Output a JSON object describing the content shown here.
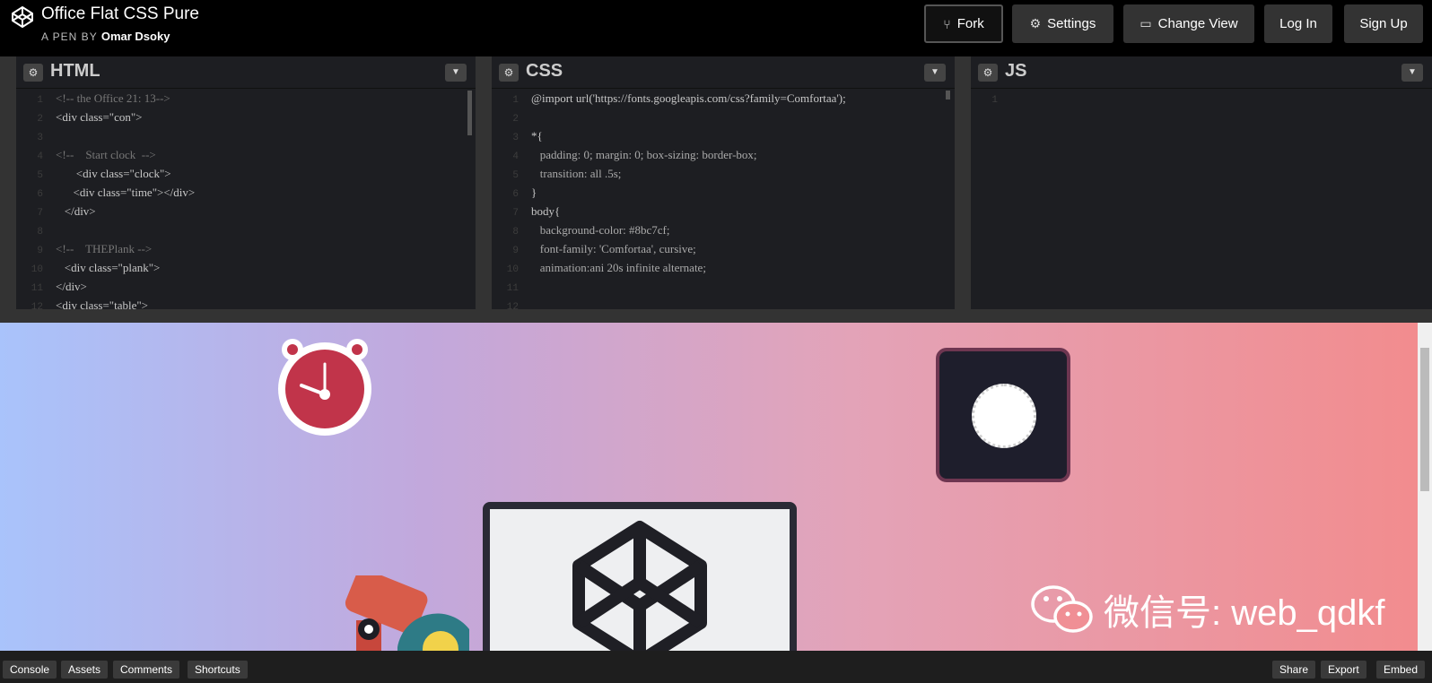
{
  "pen": {
    "title": "Office Flat CSS Pure",
    "byline_prefix": "A PEN BY",
    "author": "Omar Dsoky"
  },
  "header_buttons": {
    "fork": "Fork",
    "settings": "Settings",
    "change_view": "Change View",
    "login": "Log In",
    "signup": "Sign Up"
  },
  "panes": {
    "html": {
      "name": "HTML",
      "lines": [
        {
          "n": "1",
          "text": "<!-- the Office 21: 13-->",
          "cls": "cm"
        },
        {
          "n": "2",
          "text": "<div class=\"con\">",
          "cls": "tg"
        },
        {
          "n": "3",
          "text": "",
          "cls": "tg"
        },
        {
          "n": "4",
          "text": "<!--    Start clock  -->",
          "cls": "cm"
        },
        {
          "n": "5",
          "text": "       <div class=\"clock\">",
          "cls": "tg"
        },
        {
          "n": "6",
          "text": "      <div class=\"time\"></div>",
          "cls": "tg"
        },
        {
          "n": "7",
          "text": "   </div>",
          "cls": "tg"
        },
        {
          "n": "8",
          "text": "",
          "cls": "tg"
        },
        {
          "n": "9",
          "text": "<!--    THEPlank -->",
          "cls": "cm"
        },
        {
          "n": "10",
          "text": "   <div class=\"plank\">",
          "cls": "tg"
        },
        {
          "n": "11",
          "text": "</div>",
          "cls": "tg"
        },
        {
          "n": "12",
          "text": "<div class=\"table\">",
          "cls": "tg"
        }
      ]
    },
    "css": {
      "name": "CSS",
      "lines": [
        {
          "n": "1",
          "text": "@import url('https://fonts.googleapis.com/css?family=Comfortaa');",
          "cls": "tg"
        },
        {
          "n": "2",
          "text": "",
          "cls": "tg"
        },
        {
          "n": "3",
          "text": "*{",
          "cls": "tg"
        },
        {
          "n": "4",
          "text": "   padding: 0; margin: 0; box-sizing: border-box;",
          "cls": "pr"
        },
        {
          "n": "5",
          "text": "   transition: all .5s;",
          "cls": "pr"
        },
        {
          "n": "6",
          "text": "}",
          "cls": "tg"
        },
        {
          "n": "7",
          "text": "body{",
          "cls": "tg"
        },
        {
          "n": "8",
          "text": "   background-color: #8bc7cf;",
          "cls": "pr"
        },
        {
          "n": "9",
          "text": "   font-family: 'Comfortaa', cursive;",
          "cls": "pr"
        },
        {
          "n": "10",
          "text": "   animation:ani 20s infinite alternate;",
          "cls": "pr"
        },
        {
          "n": "11",
          "text": "",
          "cls": "tg"
        },
        {
          "n": "12",
          "text": "",
          "cls": "tg"
        }
      ]
    },
    "js": {
      "name": "JS",
      "lines": [
        {
          "n": "1",
          "text": "",
          "cls": "tg"
        }
      ]
    }
  },
  "watermark": {
    "text": "微信号: web_qdkf"
  },
  "bottom_buttons": {
    "console": "Console",
    "assets": "Assets",
    "comments": "Comments",
    "shortcuts": "Shortcuts",
    "share": "Share",
    "export": "Export",
    "embed": "Embed"
  },
  "colors": {
    "clock_red": "#c1344a",
    "box_dark": "#1e1e2c",
    "editor_bg": "#1d1e22"
  }
}
